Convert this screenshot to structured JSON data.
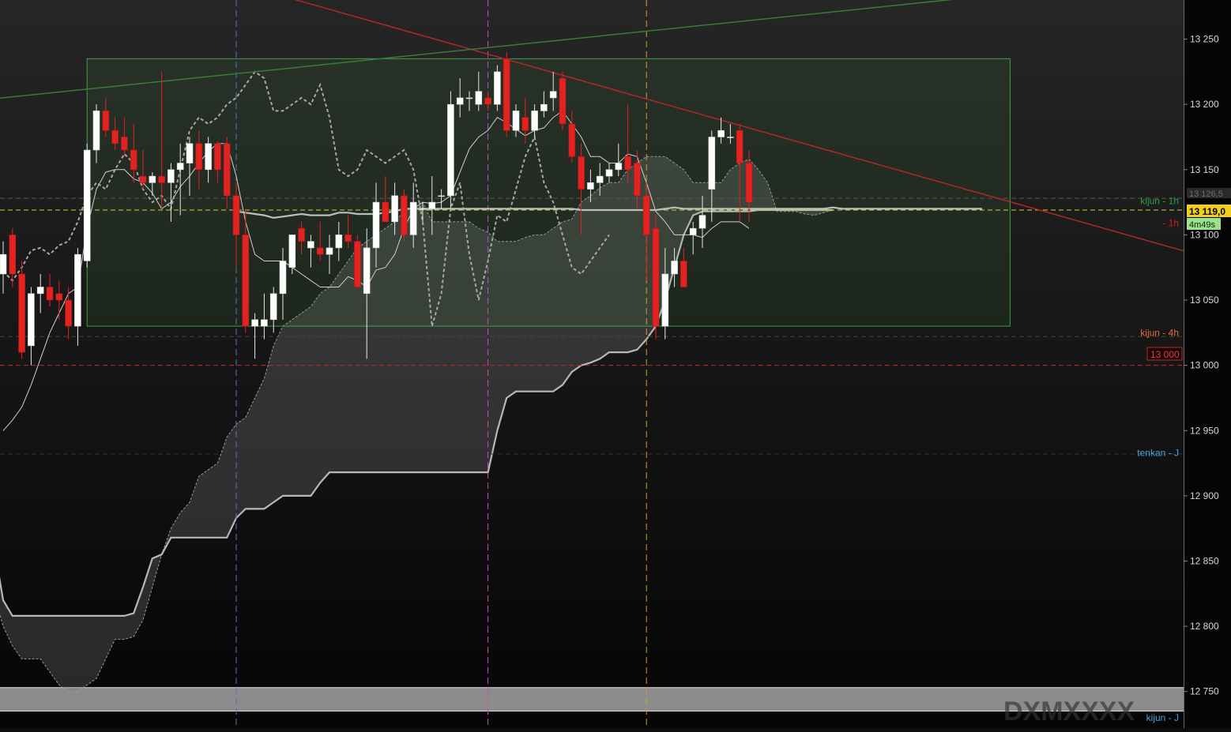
{
  "chart_data": {
    "type": "candlestick",
    "instrument_watermark": "DXMXXXX",
    "ylim": [
      12722,
      13280
    ],
    "y_ticks": [
      {
        "value": 13250,
        "label": "13 250"
      },
      {
        "value": 13200,
        "label": "13 200"
      },
      {
        "value": 13150,
        "label": "13 150"
      },
      {
        "value": 13100,
        "label": "13 100"
      },
      {
        "value": 13050,
        "label": "13 050"
      },
      {
        "value": 13000,
        "label": "13 000"
      },
      {
        "value": 12950,
        "label": "12 950"
      },
      {
        "value": 12900,
        "label": "12 900"
      },
      {
        "value": 12850,
        "label": "12 850"
      },
      {
        "value": 12800,
        "label": "12 800"
      },
      {
        "value": 12750,
        "label": "12 750"
      }
    ],
    "price_labels": {
      "current": "13 119,0",
      "countdown": "4m49s",
      "faded": "13 126,5",
      "round_level": "13 000"
    },
    "level_labels": [
      {
        "text": "kijun - 1h",
        "value": 13126,
        "color": "#2ea043"
      },
      {
        "text": "- 1h",
        "value": 13109,
        "color": "#d02020"
      },
      {
        "text": "kijun - 4h",
        "value": 13025,
        "color": "#e0703a"
      },
      {
        "text": "tenkan - J",
        "value": 12933,
        "color": "#4aa3df"
      },
      {
        "text": "kijun - J",
        "value": 12730,
        "color": "#4aa3df"
      }
    ],
    "horizontal_levels": [
      {
        "value": 13119,
        "color": "#c8d23a",
        "style": "dashed"
      },
      {
        "value": 13000,
        "color": "#c0282e",
        "style": "dashed"
      },
      {
        "value": 13022,
        "color": "#444444",
        "style": "dashed"
      },
      {
        "value": 12932,
        "color": "#333333",
        "style": "dashed"
      },
      {
        "value": 13128,
        "color": "#555555",
        "style": "dashed"
      }
    ],
    "vertical_markers": [
      {
        "bar": 25,
        "color": "#4a78c8"
      },
      {
        "bar": 52,
        "color": "#c050c0"
      },
      {
        "bar": 69,
        "color": "#d0a030"
      }
    ],
    "zone": {
      "bar_start": 9,
      "bar_end": 108,
      "top": 13235,
      "bottom": 13030,
      "color": "#4caf50"
    },
    "band": {
      "top": 12753,
      "bottom": 12735,
      "color": "#8c8c8c"
    },
    "trendlines": [
      {
        "bar1": 29,
        "v1": 13285,
        "bar2": 123,
        "v2": 13095,
        "color": "#b02828"
      },
      {
        "bar1": 0,
        "v1": 13205,
        "bar2": 108,
        "v2": 13285,
        "color": "#3a7a3a"
      }
    ],
    "candles": [
      [
        13070,
        13095,
        13055,
        13085
      ],
      [
        13100,
        13105,
        13060,
        13070
      ],
      [
        13070,
        13080,
        13005,
        13010
      ],
      [
        13015,
        13060,
        13000,
        13055
      ],
      [
        13055,
        13070,
        13040,
        13060
      ],
      [
        13060,
        13070,
        13045,
        13050
      ],
      [
        13055,
        13065,
        13035,
        13050
      ],
      [
        13050,
        13060,
        13020,
        13030
      ],
      [
        13030,
        13090,
        13015,
        13085
      ],
      [
        13080,
        13170,
        13075,
        13165
      ],
      [
        13165,
        13200,
        13155,
        13195
      ],
      [
        13195,
        13205,
        13175,
        13180
      ],
      [
        13180,
        13190,
        13165,
        13170
      ],
      [
        13175,
        13190,
        13160,
        13165
      ],
      [
        13165,
        13185,
        13140,
        13150
      ],
      [
        13145,
        13165,
        13135,
        13140
      ],
      [
        13140,
        13148,
        13130,
        13145
      ],
      [
        13145,
        13225,
        13120,
        13140
      ],
      [
        13140,
        13155,
        13110,
        13150
      ],
      [
        13150,
        13170,
        13115,
        13155
      ],
      [
        13155,
        13175,
        13130,
        13170
      ],
      [
        13170,
        13180,
        13135,
        13150
      ],
      [
        13150,
        13175,
        13140,
        13170
      ],
      [
        13170,
        13172,
        13140,
        13150
      ],
      [
        13170,
        13175,
        13120,
        13130
      ],
      [
        13130,
        13140,
        13075,
        13100
      ],
      [
        13100,
        13120,
        13025,
        13030
      ],
      [
        13030,
        13040,
        13005,
        13035
      ],
      [
        13030,
        13055,
        13020,
        13035
      ],
      [
        13035,
        13060,
        13025,
        13055
      ],
      [
        13055,
        13090,
        13035,
        13080
      ],
      [
        13075,
        13100,
        13070,
        13100
      ],
      [
        13105,
        13110,
        13085,
        13095
      ],
      [
        13090,
        13100,
        13075,
        13095
      ],
      [
        13090,
        13110,
        13080,
        13085
      ],
      [
        13085,
        13100,
        13070,
        13090
      ],
      [
        13090,
        13110,
        13080,
        13100
      ],
      [
        13100,
        13115,
        13090,
        13095
      ],
      [
        13095,
        13100,
        13060,
        13060
      ],
      [
        13055,
        13105,
        13005,
        13090
      ],
      [
        13090,
        13140,
        13075,
        13125
      ],
      [
        13125,
        13145,
        13110,
        13110
      ],
      [
        13110,
        13140,
        13100,
        13130
      ],
      [
        13130,
        13135,
        13095,
        13100
      ],
      [
        13100,
        13140,
        13090,
        13125
      ],
      [
        13120,
        13125,
        13110,
        13120
      ],
      [
        13120,
        13145,
        13100,
        13125
      ],
      [
        13130,
        13135,
        13120,
        13130
      ],
      [
        13130,
        13210,
        13120,
        13200
      ],
      [
        13200,
        13220,
        13190,
        13205
      ],
      [
        13205,
        13210,
        13195,
        13205
      ],
      [
        13200,
        13225,
        13195,
        13210
      ],
      [
        13205,
        13210,
        13195,
        13200
      ],
      [
        13200,
        13230,
        13195,
        13225
      ],
      [
        13235,
        13240,
        13175,
        13180
      ],
      [
        13180,
        13200,
        13175,
        13195
      ],
      [
        13190,
        13205,
        13170,
        13180
      ],
      [
        13180,
        13200,
        13175,
        13195
      ],
      [
        13195,
        13210,
        13190,
        13200
      ],
      [
        13205,
        13225,
        13195,
        13210
      ],
      [
        13220,
        13225,
        13180,
        13185
      ],
      [
        13185,
        13195,
        13155,
        13160
      ],
      [
        13160,
        13170,
        13100,
        13135
      ],
      [
        13135,
        13150,
        13125,
        13140
      ],
      [
        13140,
        13155,
        13130,
        13145
      ],
      [
        13145,
        13155,
        13140,
        13150
      ],
      [
        13150,
        13170,
        13145,
        13155
      ],
      [
        13160,
        13200,
        13140,
        13150
      ],
      [
        13155,
        13165,
        13120,
        13130
      ],
      [
        13130,
        13140,
        13065,
        13100
      ],
      [
        13105,
        13115,
        13020,
        13030
      ],
      [
        13030,
        13090,
        13020,
        13070
      ],
      [
        13070,
        13090,
        13060,
        13080
      ],
      [
        13080,
        13090,
        13060,
        13060
      ],
      [
        13100,
        13110,
        13085,
        13105
      ],
      [
        13105,
        13130,
        13090,
        13115
      ],
      [
        13135,
        13180,
        13110,
        13175
      ],
      [
        13175,
        13190,
        13170,
        13180
      ],
      [
        13175,
        13185,
        13170,
        13175
      ],
      [
        13180,
        13185,
        13110,
        13155
      ],
      [
        13155,
        13165,
        13110,
        13125
      ]
    ],
    "cloud": {
      "start_bar": -9,
      "span_a": [
        12868,
        12866,
        12864,
        12855,
        12850,
        12845,
        12840,
        12835,
        12825,
        12800,
        12785,
        12775,
        12775,
        12775,
        12765,
        12755,
        12750,
        12750,
        12755,
        12760,
        12775,
        12790,
        12790,
        12792,
        12805,
        12830,
        12855,
        12875,
        12887,
        12895,
        12915,
        12920,
        12925,
        12945,
        12955,
        12960,
        12975,
        12990,
        13015,
        13030,
        13035,
        13040,
        13045,
        13055,
        13060,
        13070,
        13080,
        13090,
        13095,
        13100,
        13105,
        13110,
        13118,
        13121,
        13125,
        13110,
        13110,
        13110,
        13110,
        13110,
        13105,
        13102,
        13095,
        13095,
        13095,
        13098,
        13100,
        13100,
        13105,
        13110,
        13112,
        13125,
        13130,
        13136,
        13140,
        13140,
        13150,
        13155,
        13160,
        13160,
        13160,
        13155,
        13150,
        13140,
        13140,
        13140,
        13140,
        13150,
        13155,
        13158,
        13150,
        13140,
        13118,
        13118,
        13118,
        13116,
        13115,
        13117,
        13119
      ],
      "span_b": [
        12862,
        12862,
        12862,
        12862,
        12862,
        12862,
        12862,
        12862,
        12862,
        12820,
        12808,
        12808,
        12808,
        12808,
        12808,
        12808,
        12808,
        12808,
        12808,
        12808,
        12808,
        12808,
        12808,
        12810,
        12830,
        12852,
        12855,
        12868,
        12868,
        12868,
        12868,
        12868,
        12868,
        12868,
        12883,
        12890,
        12890,
        12890,
        12895,
        12900,
        12900,
        12900,
        12900,
        12910,
        12918,
        12918,
        12918,
        12918,
        12918,
        12918,
        12918,
        12918,
        12918,
        12918,
        12918,
        12918,
        12918,
        12918,
        12918,
        12918,
        12918,
        12918,
        12950,
        12975,
        12980,
        12980,
        12980,
        12980,
        12980,
        12985,
        12995,
        13000,
        13002,
        13005,
        13010,
        13010,
        13010,
        13012,
        13020,
        13030,
        13050,
        13075,
        13100,
        13115,
        13118,
        13118,
        13118,
        13118,
        13118,
        13118,
        13119,
        13119,
        13119,
        13119,
        13119,
        13119,
        13119,
        13119,
        13119
      ]
    },
    "tenkan": [
      12950,
      12958,
      12968,
      12985,
      13005,
      13025,
      13040,
      13055,
      13060,
      13105,
      13135,
      13148,
      13150,
      13150,
      13143,
      13140,
      13132,
      13120,
      13125,
      13137,
      13145,
      13155,
      13164,
      13170,
      13170,
      13145,
      13110,
      13085,
      13080,
      13080,
      13080,
      13075,
      13070,
      13065,
      13060,
      13060,
      13060,
      13068,
      13065,
      13060,
      13073,
      13075,
      13085,
      13105,
      13120,
      13125,
      13124,
      13125,
      13130,
      13148,
      13166,
      13175,
      13180,
      13190,
      13186,
      13181,
      13176,
      13180,
      13182,
      13190,
      13195,
      13185,
      13175,
      13160,
      13160,
      13155,
      13155,
      13162,
      13160,
      13140,
      13118,
      13110,
      13100,
      13100,
      13100,
      13098,
      13105,
      13110,
      13110,
      13110,
      13105
    ],
    "kijun": [
      13118,
      13117,
      13116,
      13115,
      13113,
      13114,
      13115,
      13116,
      13115,
      13115,
      13115,
      13117,
      13117,
      13116,
      13116,
      13116,
      13117,
      13118,
      13120,
      13120,
      13120,
      13120,
      13120,
      13120,
      13120,
      13120,
      13120,
      13120,
      13120,
      13120,
      13120,
      13120,
      13120,
      13120,
      13120,
      13120,
      13120,
      13119,
      13119,
      13119,
      13119,
      13119,
      13119,
      13119,
      13119,
      13119,
      13120,
      13121,
      13120,
      13120,
      13120,
      13120,
      13120,
      13120,
      13120,
      13120,
      13120,
      13120,
      13120,
      13120,
      13120,
      13120,
      13120,
      13120,
      13121,
      13120,
      13120,
      13120,
      13120,
      13120,
      13120,
      13120,
      13120,
      13120,
      13120,
      13120,
      13120,
      13120,
      13120,
      13120,
      13120
    ],
    "chikou": [
      13072,
      13065,
      13075,
      13088,
      13090,
      13085,
      13092,
      13095,
      13110,
      13130,
      13140,
      13135,
      13150,
      13162,
      13155,
      13135,
      13125,
      13130,
      13120,
      13150,
      13180,
      13190,
      13185,
      13190,
      13200,
      13205,
      13215,
      13225,
      13220,
      13195,
      13195,
      13200,
      13205,
      13200,
      13215,
      13190,
      13150,
      13145,
      13150,
      13165,
      13160,
      13155,
      13160,
      13165,
      13150,
      13110,
      13030,
      13055,
      13120,
      13140,
      13085,
      13050,
      13080,
      13115,
      13110,
      13135,
      13160,
      13175,
      13140,
      13125,
      13100,
      13075,
      13070,
      13080,
      13090,
      13100
    ]
  }
}
